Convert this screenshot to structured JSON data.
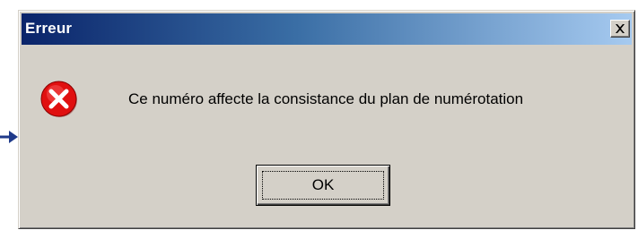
{
  "window": {
    "title": "Erreur",
    "close_icon": "close-icon"
  },
  "dialog": {
    "icon": "error-icon",
    "message": "Ce numéro affecte la consistance du plan de numérotation",
    "ok_label": "OK"
  },
  "colors": {
    "titlebar_start": "#0a246a",
    "titlebar_end": "#a6caf0",
    "dialog_bg": "#d4d0c8",
    "error_red": "#e01010",
    "arrow": "#1f3a8a"
  }
}
